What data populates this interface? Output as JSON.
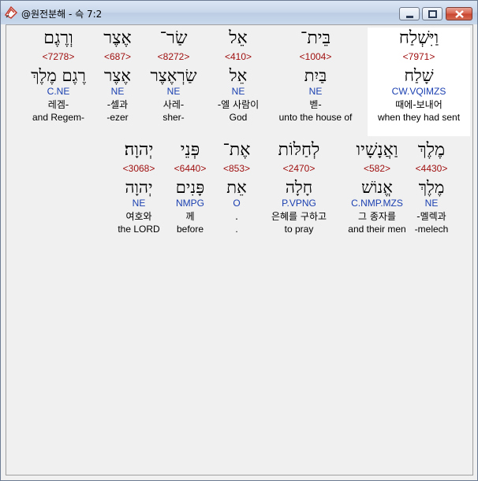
{
  "window": {
    "title": "@원전분해 - 슥 7:2",
    "controls": [
      "minimize-icon",
      "maximize-icon",
      "close-icon"
    ]
  },
  "verse": {
    "rows": [
      {
        "words": [
          {
            "hebrew": "וַיִּשְׁלַח",
            "strong": "<7971>",
            "lemma": "שָׁלַח",
            "parse": "CW.VQIMZS",
            "korean": "때에-보내어",
            "english": "when they had sent",
            "highlight": true
          },
          {
            "hebrew": "בֵּית־",
            "strong": "<1004>",
            "lemma": "בַּיִת",
            "parse": "NE",
            "korean": "벧-",
            "english": "unto the house of"
          },
          {
            "hebrew": "אֵל",
            "strong": "<410>",
            "lemma": "אֵל",
            "parse": "NE",
            "korean": "-엘 사람이",
            "english": "God"
          },
          {
            "hebrew": "שַׂר־",
            "strong": "<8272>",
            "lemma": "שַׂרְאֶצֶר",
            "parse": "NE",
            "korean": "사레-",
            "english": "sher-"
          },
          {
            "hebrew": "אֶצֶר",
            "strong": "<687>",
            "lemma": "אֶצֶר",
            "parse": "NE",
            "korean": "-셀과",
            "english": "-ezer"
          },
          {
            "hebrew": "וְרֶגֶם",
            "strong": "<7278>",
            "lemma": "רֶגֶם מֶלֶךְ",
            "parse": "C.NE",
            "korean": "레겜-",
            "english": "and Regem-"
          }
        ]
      },
      {
        "words": [
          {
            "hebrew": "מֶלֶךְ",
            "strong": "<4430>",
            "lemma": "מֶלֶךְ",
            "parse": "NE",
            "korean": "-멜렉과",
            "english": "-melech"
          },
          {
            "hebrew": "וַאֲנָשָׁיו",
            "strong": "<582>",
            "lemma": "אֱנוֹשׁ",
            "parse": "C.NMP.MZS",
            "korean": "그 종자를",
            "english": "and their men"
          },
          {
            "hebrew": "לְחַלּוֹת",
            "strong": "<2470>",
            "lemma": "חָלָה",
            "parse": "P.VPNG",
            "korean": "은혜를 구하고",
            "english": "to pray"
          },
          {
            "hebrew": "אֶת־",
            "strong": "<853>",
            "lemma": "אֵת",
            "parse": "O",
            "korean": ".",
            "english": "."
          },
          {
            "hebrew": "פְּנֵי",
            "strong": "<6440>",
            "lemma": "פָּנִים",
            "parse": "NMPG",
            "korean": "께",
            "english": "before"
          },
          {
            "hebrew": "יְהוָה׃",
            "strong": "<3068>",
            "lemma": "יְהוָה",
            "parse": "NE",
            "korean": "여호와",
            "english": "the LORD"
          }
        ]
      }
    ]
  }
}
